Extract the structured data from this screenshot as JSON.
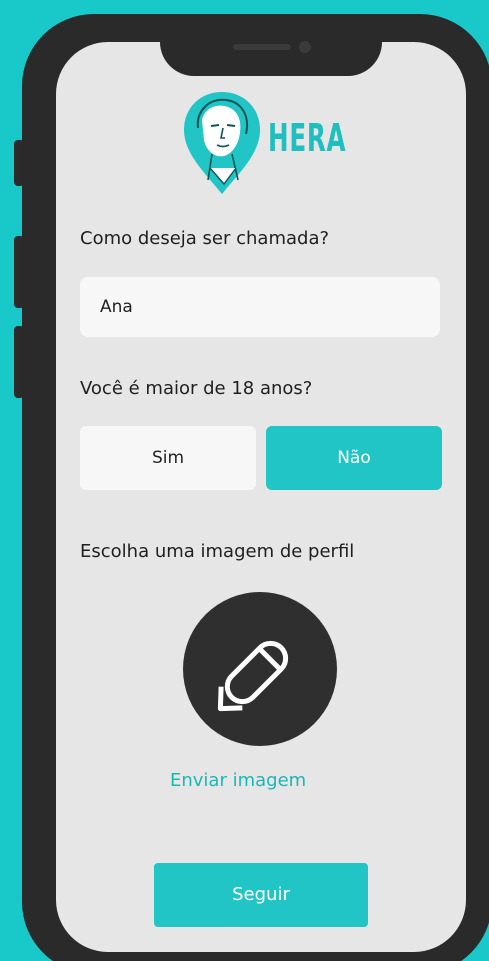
{
  "app": {
    "logo_text": "HERA"
  },
  "form": {
    "name_question": "Como deseja ser chamada?",
    "name_value": "Ana",
    "age_question": "Você é maior de 18 anos?",
    "age_options": {
      "yes_label": "Sim",
      "no_label": "Não",
      "selected": "Não"
    },
    "avatar_prompt": "Escolha uma imagem de perfil",
    "avatar_icon": "pencil-icon",
    "upload_label": "Enviar imagem",
    "continue_label": "Seguir"
  },
  "colors": {
    "background": "#19c8c8",
    "accent": "#22c5c5",
    "phone_frame": "#2a2a2a",
    "screen": "#e6e6e6"
  }
}
